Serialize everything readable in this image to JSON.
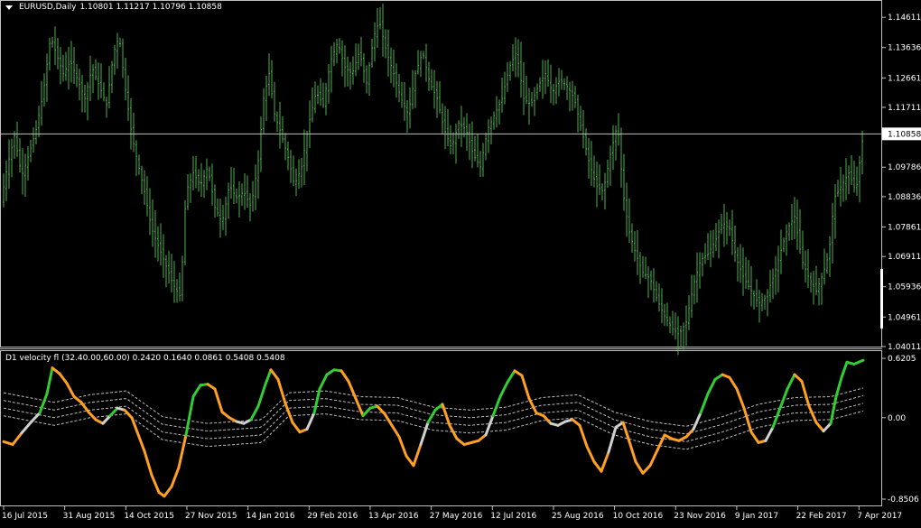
{
  "header": {
    "symbol": "EURUSD,Daily",
    "ohlc": "1.10801 1.11217 1.10796 1.10858"
  },
  "indicator": {
    "label": "D1 velocity fl (32.40.00,60.00) 0.2420 0.1640 0.0861 0.5408 0.5408"
  },
  "colors": {
    "bg": "#000000",
    "bar": "#4caf50",
    "axis": "#c0c0c0",
    "current_line": "#c0c0c0",
    "vel_up": "#32cd32",
    "vel_down": "#ffa020",
    "vel_neutral": "#d0d0d0",
    "band": "#c0c0c0"
  },
  "chart_data": [
    {
      "type": "ohlc",
      "ylim": [
        1.0401,
        1.1511
      ],
      "current_price": 1.10858,
      "yticks": [
        "1.14611",
        "1.13636",
        "1.12661",
        "1.11711",
        "1.10858",
        "1.09786",
        "1.08836",
        "1.07861",
        "1.06911",
        "1.05936",
        "1.04961",
        "1.04011"
      ],
      "ytick_values": [
        1.14611,
        1.13636,
        1.12661,
        1.11711,
        1.10858,
        1.09786,
        1.08836,
        1.07861,
        1.06911,
        1.05936,
        1.04961,
        1.04011
      ],
      "xticks": [
        "16 Jul 2015",
        "31 Aug 2015",
        "14 Oct 2015",
        "27 Nov 2015",
        "14 Jan 2016",
        "29 Feb 2016",
        "13 Apr 2016",
        "27 May 2016",
        "12 Jul 2016",
        "25 Aug 2016",
        "10 Oct 2016",
        "23 Nov 2016",
        "9 Jan 2017",
        "22 Feb 2017",
        "7 Apr 2017"
      ],
      "close_path": [
        [
          0,
          1.085
        ],
        [
          8,
          1.098
        ],
        [
          16,
          1.108
        ],
        [
          24,
          1.095
        ],
        [
          32,
          1.102
        ],
        [
          40,
          1.11
        ],
        [
          48,
          1.122
        ],
        [
          56,
          1.14
        ],
        [
          64,
          1.133
        ],
        [
          70,
          1.128
        ],
        [
          78,
          1.132
        ],
        [
          86,
          1.126
        ],
        [
          94,
          1.12
        ],
        [
          102,
          1.13
        ],
        [
          110,
          1.124
        ],
        [
          118,
          1.118
        ],
        [
          126,
          1.135
        ],
        [
          132,
          1.14
        ],
        [
          138,
          1.125
        ],
        [
          146,
          1.108
        ],
        [
          152,
          1.1
        ],
        [
          160,
          1.09
        ],
        [
          168,
          1.078
        ],
        [
          176,
          1.072
        ],
        [
          184,
          1.066
        ],
        [
          192,
          1.06
        ],
        [
          200,
          1.056
        ],
        [
          206,
          1.09
        ],
        [
          214,
          1.096
        ],
        [
          222,
          1.092
        ],
        [
          230,
          1.098
        ],
        [
          238,
          1.085
        ],
        [
          246,
          1.08
        ],
        [
          254,
          1.092
        ],
        [
          262,
          1.088
        ],
        [
          270,
          1.09
        ],
        [
          278,
          1.085
        ],
        [
          286,
          1.1
        ],
        [
          292,
          1.12
        ],
        [
          298,
          1.128
        ],
        [
          304,
          1.115
        ],
        [
          312,
          1.108
        ],
        [
          320,
          1.1
        ],
        [
          326,
          1.092
        ],
        [
          334,
          1.098
        ],
        [
          342,
          1.112
        ],
        [
          350,
          1.122
        ],
        [
          358,
          1.118
        ],
        [
          366,
          1.132
        ],
        [
          374,
          1.138
        ],
        [
          382,
          1.13
        ],
        [
          390,
          1.128
        ],
        [
          398,
          1.135
        ],
        [
          406,
          1.125
        ],
        [
          414,
          1.14
        ],
        [
          420,
          1.145
        ],
        [
          428,
          1.135
        ],
        [
          436,
          1.128
        ],
        [
          444,
          1.12
        ],
        [
          452,
          1.115
        ],
        [
          460,
          1.128
        ],
        [
          468,
          1.135
        ],
        [
          476,
          1.125
        ],
        [
          484,
          1.12
        ],
        [
          492,
          1.11
        ],
        [
          500,
          1.104
        ],
        [
          508,
          1.112
        ],
        [
          516,
          1.11
        ],
        [
          524,
          1.102
        ],
        [
          532,
          1.098
        ],
        [
          540,
          1.11
        ],
        [
          548,
          1.115
        ],
        [
          556,
          1.12
        ],
        [
          564,
          1.13
        ],
        [
          572,
          1.135
        ],
        [
          580,
          1.12
        ],
        [
          588,
          1.118
        ],
        [
          596,
          1.124
        ],
        [
          604,
          1.128
        ],
        [
          612,
          1.122
        ],
        [
          620,
          1.126
        ],
        [
          628,
          1.124
        ],
        [
          636,
          1.12
        ],
        [
          644,
          1.11
        ],
        [
          652,
          1.1
        ],
        [
          660,
          1.092
        ],
        [
          668,
          1.09
        ],
        [
          676,
          1.102
        ],
        [
          684,
          1.112
        ],
        [
          690,
          1.09
        ],
        [
          696,
          1.078
        ],
        [
          704,
          1.07
        ],
        [
          712,
          1.064
        ],
        [
          720,
          1.062
        ],
        [
          728,
          1.055
        ],
        [
          736,
          1.05
        ],
        [
          744,
          1.046
        ],
        [
          752,
          1.044
        ],
        [
          760,
          1.048
        ],
        [
          768,
          1.06
        ],
        [
          776,
          1.068
        ],
        [
          784,
          1.07
        ],
        [
          792,
          1.074
        ],
        [
          800,
          1.08
        ],
        [
          808,
          1.078
        ],
        [
          816,
          1.068
        ],
        [
          824,
          1.062
        ],
        [
          832,
          1.058
        ],
        [
          840,
          1.054
        ],
        [
          848,
          1.056
        ],
        [
          856,
          1.062
        ],
        [
          864,
          1.07
        ],
        [
          872,
          1.078
        ],
        [
          880,
          1.082
        ],
        [
          888,
          1.068
        ],
        [
          896,
          1.062
        ],
        [
          904,
          1.058
        ],
        [
          912,
          1.064
        ],
        [
          918,
          1.07
        ],
        [
          924,
          1.088
        ],
        [
          932,
          1.092
        ],
        [
          940,
          1.096
        ],
        [
          948,
          1.09
        ],
        [
          956,
          1.1085
        ]
      ]
    },
    {
      "type": "line",
      "ylim": [
        -0.8506,
        0.6205
      ],
      "yticks": [
        "0.6205",
        "0.00",
        "-0.8506"
      ],
      "ytick_values": [
        0.6205,
        0.0,
        -0.8506
      ],
      "velocity": [
        [
          4,
          -0.25
        ],
        [
          14,
          -0.28
        ],
        [
          24,
          -0.16
        ],
        [
          34,
          -0.05
        ],
        [
          44,
          0.05
        ],
        [
          52,
          0.25
        ],
        [
          58,
          0.52
        ],
        [
          66,
          0.46
        ],
        [
          74,
          0.36
        ],
        [
          82,
          0.22
        ],
        [
          90,
          0.16
        ],
        [
          98,
          0.06
        ],
        [
          106,
          -0.02
        ],
        [
          114,
          -0.06
        ],
        [
          122,
          0.02
        ],
        [
          130,
          0.1
        ],
        [
          138,
          0.08
        ],
        [
          146,
          0.0
        ],
        [
          152,
          -0.15
        ],
        [
          160,
          -0.35
        ],
        [
          168,
          -0.6
        ],
        [
          176,
          -0.78
        ],
        [
          182,
          -0.82
        ],
        [
          190,
          -0.72
        ],
        [
          198,
          -0.52
        ],
        [
          206,
          -0.18
        ],
        [
          214,
          0.22
        ],
        [
          222,
          0.34
        ],
        [
          230,
          0.35
        ],
        [
          238,
          0.3
        ],
        [
          246,
          0.06
        ],
        [
          254,
          0.0
        ],
        [
          262,
          -0.04
        ],
        [
          270,
          -0.06
        ],
        [
          278,
          -0.02
        ],
        [
          286,
          0.12
        ],
        [
          294,
          0.35
        ],
        [
          300,
          0.5
        ],
        [
          308,
          0.4
        ],
        [
          316,
          0.15
        ],
        [
          324,
          -0.05
        ],
        [
          332,
          -0.15
        ],
        [
          340,
          -0.12
        ],
        [
          348,
          0.05
        ],
        [
          354,
          0.3
        ],
        [
          362,
          0.45
        ],
        [
          370,
          0.5
        ],
        [
          378,
          0.49
        ],
        [
          386,
          0.38
        ],
        [
          394,
          0.2
        ],
        [
          402,
          0.02
        ],
        [
          410,
          0.1
        ],
        [
          418,
          0.12
        ],
        [
          426,
          0.04
        ],
        [
          434,
          -0.08
        ],
        [
          442,
          -0.2
        ],
        [
          450,
          -0.4
        ],
        [
          458,
          -0.5
        ],
        [
          466,
          -0.28
        ],
        [
          474,
          -0.05
        ],
        [
          482,
          0.08
        ],
        [
          490,
          0.14
        ],
        [
          498,
          -0.08
        ],
        [
          506,
          -0.22
        ],
        [
          514,
          -0.28
        ],
        [
          522,
          -0.26
        ],
        [
          530,
          -0.24
        ],
        [
          538,
          -0.18
        ],
        [
          546,
          0.02
        ],
        [
          554,
          0.22
        ],
        [
          562,
          0.37
        ],
        [
          570,
          0.49
        ],
        [
          578,
          0.44
        ],
        [
          586,
          0.2
        ],
        [
          594,
          0.05
        ],
        [
          602,
          0.02
        ],
        [
          610,
          -0.06
        ],
        [
          618,
          -0.08
        ],
        [
          626,
          -0.04
        ],
        [
          634,
          -0.02
        ],
        [
          642,
          -0.08
        ],
        [
          650,
          -0.3
        ],
        [
          658,
          -0.46
        ],
        [
          666,
          -0.56
        ],
        [
          674,
          -0.36
        ],
        [
          682,
          -0.1
        ],
        [
          690,
          -0.05
        ],
        [
          696,
          -0.22
        ],
        [
          704,
          -0.46
        ],
        [
          712,
          -0.58
        ],
        [
          720,
          -0.5
        ],
        [
          728,
          -0.34
        ],
        [
          736,
          -0.18
        ],
        [
          744,
          -0.22
        ],
        [
          752,
          -0.24
        ],
        [
          760,
          -0.2
        ],
        [
          768,
          -0.12
        ],
        [
          776,
          0.05
        ],
        [
          784,
          0.25
        ],
        [
          792,
          0.4
        ],
        [
          800,
          0.45
        ],
        [
          808,
          0.42
        ],
        [
          816,
          0.3
        ],
        [
          824,
          0.1
        ],
        [
          832,
          -0.15
        ],
        [
          840,
          -0.26
        ],
        [
          848,
          -0.24
        ],
        [
          856,
          -0.1
        ],
        [
          864,
          0.1
        ],
        [
          872,
          0.3
        ],
        [
          880,
          0.45
        ],
        [
          888,
          0.38
        ],
        [
          896,
          0.12
        ],
        [
          904,
          -0.05
        ],
        [
          912,
          -0.14
        ],
        [
          920,
          -0.06
        ],
        [
          926,
          0.22
        ],
        [
          932,
          0.42
        ],
        [
          938,
          0.58
        ],
        [
          946,
          0.56
        ],
        [
          956,
          0.6
        ]
      ],
      "band_center": [
        [
          4,
          0.1
        ],
        [
          60,
          0.0
        ],
        [
          100,
          0.08
        ],
        [
          140,
          0.12
        ],
        [
          180,
          -0.15
        ],
        [
          230,
          -0.22
        ],
        [
          290,
          -0.18
        ],
        [
          320,
          0.1
        ],
        [
          360,
          0.12
        ],
        [
          400,
          0.06
        ],
        [
          440,
          0.05
        ],
        [
          480,
          -0.05
        ],
        [
          520,
          -0.08
        ],
        [
          560,
          -0.05
        ],
        [
          600,
          0.05
        ],
        [
          640,
          0.08
        ],
        [
          680,
          -0.1
        ],
        [
          720,
          -0.2
        ],
        [
          760,
          -0.25
        ],
        [
          800,
          -0.15
        ],
        [
          840,
          -0.02
        ],
        [
          880,
          0.05
        ],
        [
          920,
          0.06
        ],
        [
          956,
          0.15
        ]
      ]
    }
  ]
}
